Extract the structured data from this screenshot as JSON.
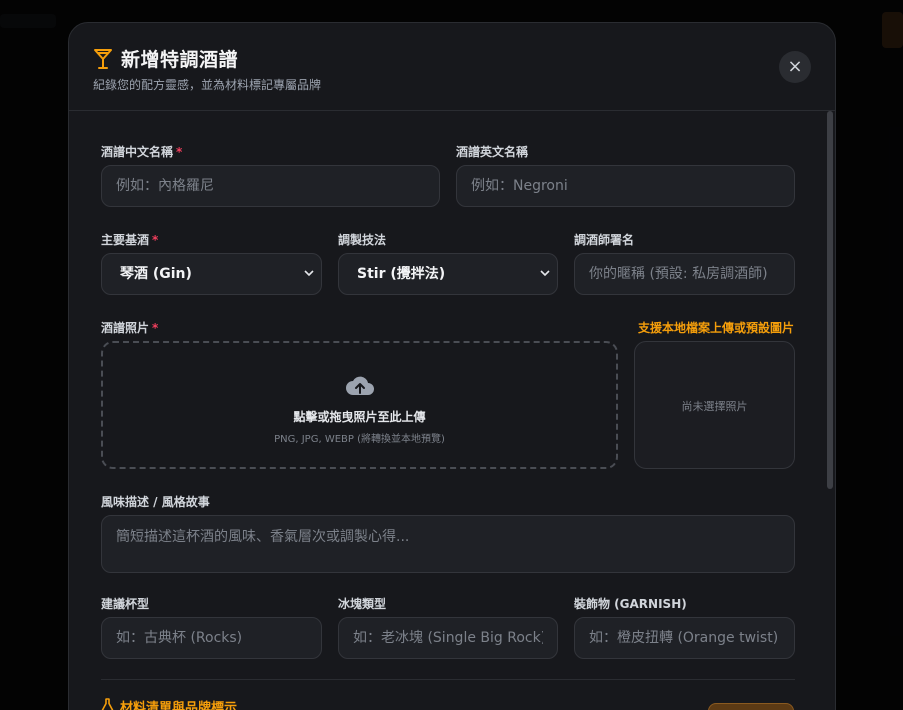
{
  "modal": {
    "title": "新增特調酒譜",
    "subtitle": "紀錄您的配方靈感，並為材料標記專屬品牌",
    "close_label": "×"
  },
  "fields": {
    "name_zh": {
      "label": "酒譜中文名稱",
      "required": "*",
      "placeholder": "例如：內格羅尼",
      "value": ""
    },
    "name_en": {
      "label": "酒譜英文名稱",
      "placeholder": "例如：Negroni",
      "value": ""
    },
    "base_spirit": {
      "label": "主要基酒",
      "required": "*",
      "selected": "琴酒 (Gin)"
    },
    "technique": {
      "label": "調製技法",
      "selected": "Stir (攪拌法)"
    },
    "bartender": {
      "label": "調酒師署名",
      "placeholder": "你的暱稱 (預設: 私房調酒師)",
      "value": ""
    },
    "photo": {
      "label": "酒譜照片",
      "required": "*",
      "hint": "支援本地檔案上傳或預設圖片",
      "dropzone_main": "點擊或拖曳照片至此上傳",
      "dropzone_sub": "PNG, JPG, WEBP (將轉換並本地預覽)",
      "preview_empty": "尚未選擇照片",
      "icon": "cloud-upload-icon"
    },
    "description": {
      "label": "風味描述 / 風格故事",
      "placeholder": "簡短描述這杯酒的風味、香氣層次或調製心得..."
    },
    "glass": {
      "label": "建議杯型",
      "placeholder": "如：古典杯 (Rocks)"
    },
    "ice": {
      "label": "冰塊類型",
      "placeholder": "如：老冰塊 (Single Big Rock)"
    },
    "garnish": {
      "label": "裝飾物 (GARNISH)",
      "placeholder": "如：橙皮扭轉 (Orange twist)"
    }
  },
  "ingredients_section": {
    "title": "材料清單與品牌標示",
    "icon": "flask-icon"
  },
  "colors": {
    "accent": "#f59e0b",
    "required": "#f43f5e",
    "modal_bg": "#17181c",
    "field_bg": "#1f2126"
  }
}
